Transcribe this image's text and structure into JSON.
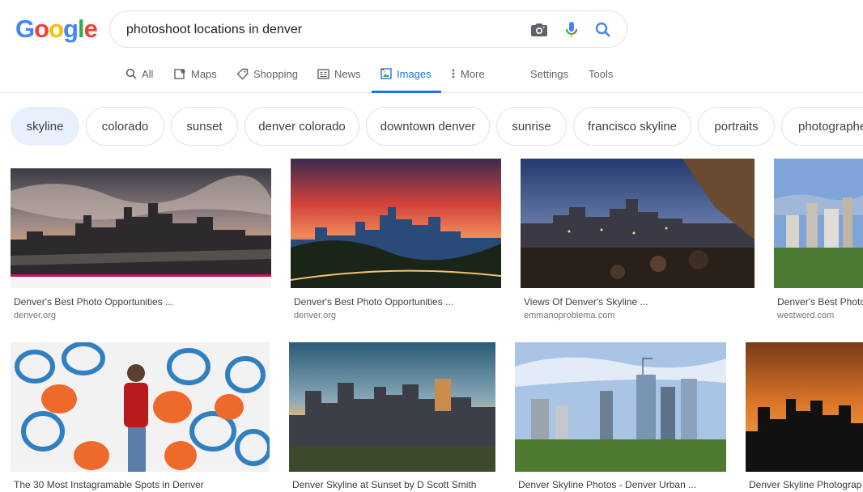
{
  "colors": {
    "accent": "#1a73e8",
    "chip_active_bg": "#e8f0fe",
    "google_blue": "#4285F4",
    "google_red": "#EA4335",
    "google_yellow": "#FBBC05",
    "google_green": "#34A853"
  },
  "logo": {
    "letters": [
      "G",
      "o",
      "o",
      "g",
      "l",
      "e"
    ]
  },
  "search": {
    "query": "photoshoot locations in denver"
  },
  "tabs": [
    {
      "label": "All",
      "icon": "search-icon"
    },
    {
      "label": "Maps",
      "icon": "map-icon"
    },
    {
      "label": "Shopping",
      "icon": "tag-icon"
    },
    {
      "label": "News",
      "icon": "news-icon"
    },
    {
      "label": "Images",
      "icon": "image-icon",
      "active": true
    },
    {
      "label": "More",
      "icon": "more-vert-icon"
    },
    {
      "label": "Settings"
    },
    {
      "label": "Tools"
    }
  ],
  "chips": [
    {
      "label": "skyline",
      "active": true
    },
    {
      "label": "colorado"
    },
    {
      "label": "sunset"
    },
    {
      "label": "denver colorado"
    },
    {
      "label": "downtown denver"
    },
    {
      "label": "sunrise"
    },
    {
      "label": "francisco skyline"
    },
    {
      "label": "portraits"
    },
    {
      "label": "photographe"
    }
  ],
  "results": [
    {
      "title": "Denver's Best Photo Opportunities ...",
      "source": "denver.org"
    },
    {
      "title": "Denver's Best Photo Opportunities ...",
      "source": "denver.org"
    },
    {
      "title": "Views Of Denver's Skyline ...",
      "source": "emmanoproblema.com"
    },
    {
      "title": "Denver's Best Photo",
      "source": "westword.com"
    },
    {
      "title": "The 30 Most Instagramable Spots in Denver",
      "source": ""
    },
    {
      "title": "Denver Skyline at Sunset by D Scott Smith",
      "source": ""
    },
    {
      "title": "Denver Skyline Photos - Denver Urban ...",
      "source": ""
    },
    {
      "title": "Denver Skyline Photograp",
      "source": ""
    }
  ]
}
